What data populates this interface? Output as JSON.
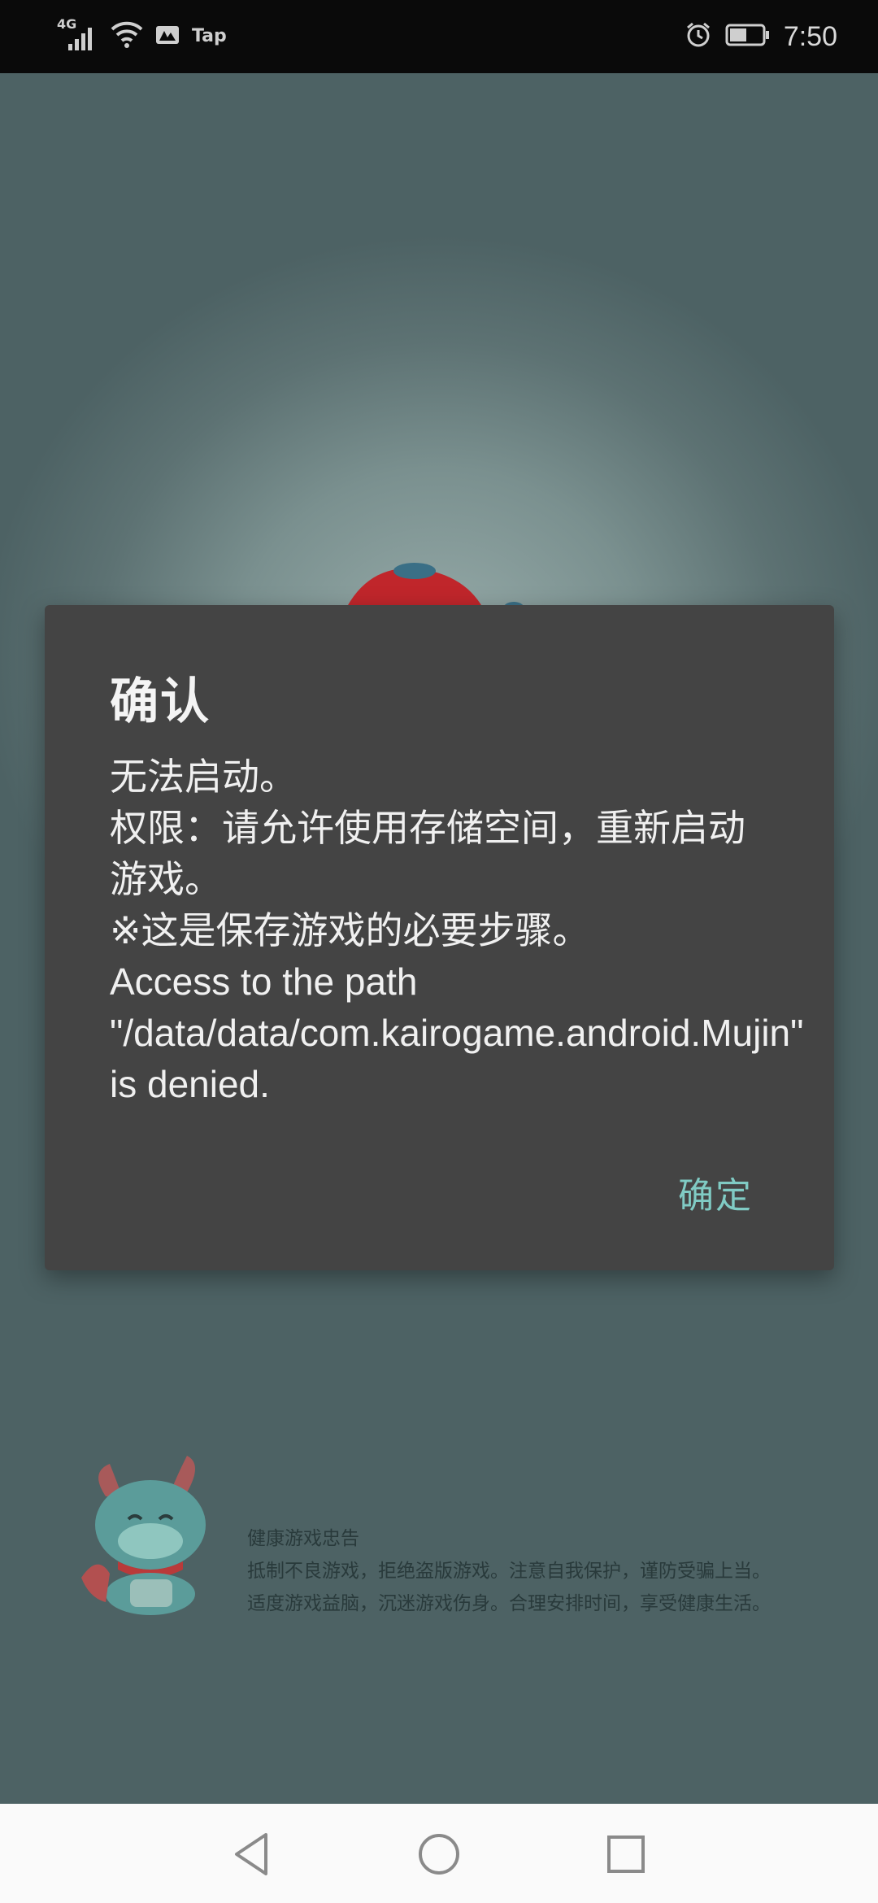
{
  "status_bar": {
    "network_label": "4G",
    "app_notification_label": "Tap",
    "time": "7:50",
    "icons": [
      "signal-icon",
      "wifi-icon",
      "notification-app-icon",
      "alarm-icon",
      "battery-icon"
    ]
  },
  "dialog": {
    "title": "确认",
    "message": "无法启动。\n权限：请允许使用存储空间，重新启动游戏。\n※这是保存游戏的必要步骤。\nAccess to the path \"/data/data/com.kairogame.android.Mujin\" is denied.",
    "ok_label": "确定"
  },
  "health_notice": {
    "title": "健康游戏忠告",
    "line1": "抵制不良游戏，拒绝盗版游戏。注意自我保护，谨防受骗上当。",
    "line2": "适度游戏益脑，沉迷游戏伤身。合理安排时间，享受健康生活。"
  },
  "nav_bar": {
    "icons": [
      "back-icon",
      "home-icon",
      "recents-icon"
    ]
  },
  "colors": {
    "background": "#4e6466",
    "dialog": "#444444",
    "accent": "#80cbc4",
    "status_bar": "#0a0a0a",
    "nav_bar": "#fafafa"
  }
}
